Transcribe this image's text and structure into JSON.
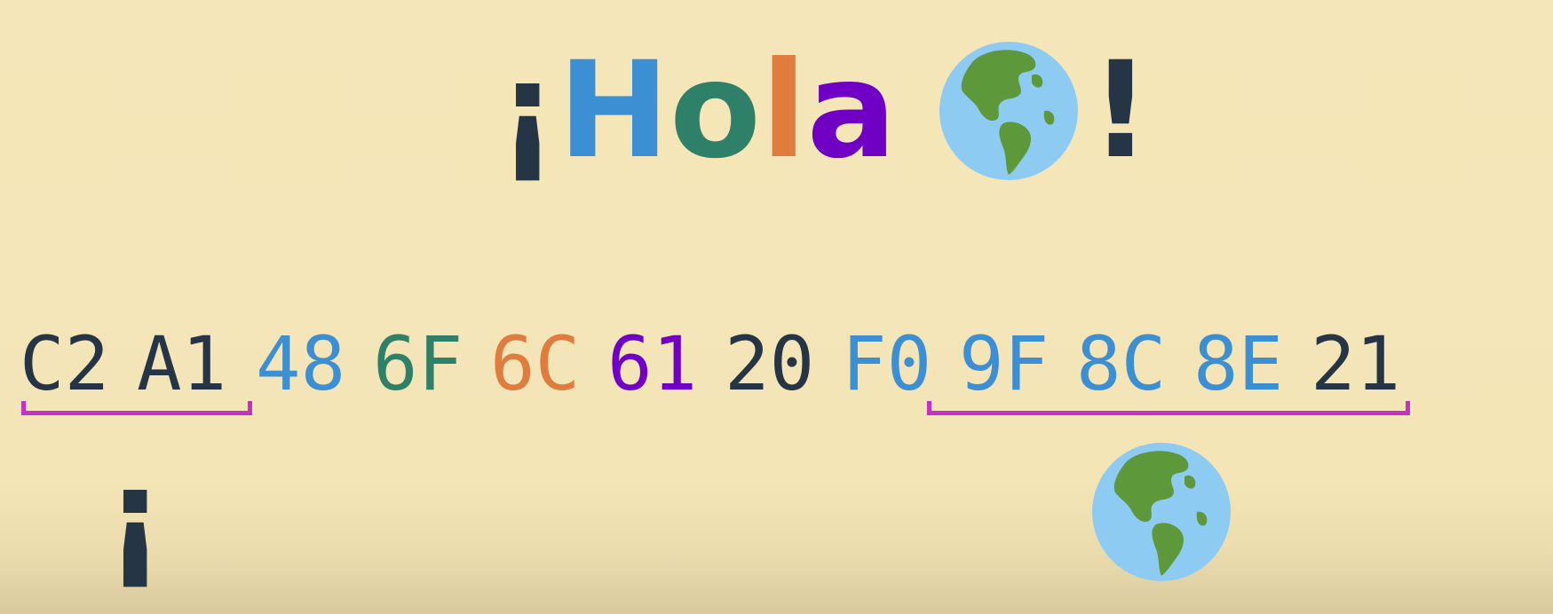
{
  "title": {
    "chars": [
      {
        "text": "¡",
        "color": "#263545"
      },
      {
        "text": "H",
        "color": "#3d8fd4"
      },
      {
        "text": "o",
        "color": "#2e8068"
      },
      {
        "text": "l",
        "color": "#e07d3e"
      },
      {
        "text": "a",
        "color": "#7000c4"
      }
    ],
    "globe_icon": "globe-americas-icon",
    "bang": {
      "text": "!",
      "color": "#263545"
    }
  },
  "bytes": [
    {
      "text": "C2",
      "color": "#263545"
    },
    {
      "text": "A1",
      "color": "#263545"
    },
    {
      "text": "48",
      "color": "#3d8fd4"
    },
    {
      "text": "6F",
      "color": "#2e8068"
    },
    {
      "text": "6C",
      "color": "#e07d3e"
    },
    {
      "text": "61",
      "color": "#7000c4"
    },
    {
      "text": "20",
      "color": "#263545"
    },
    {
      "text": "F0",
      "color": "#3d8fd4"
    },
    {
      "text": "9F",
      "color": "#3d8fd4"
    },
    {
      "text": "8C",
      "color": "#3d8fd4"
    },
    {
      "text": "8E",
      "color": "#3d8fd4"
    },
    {
      "text": "21",
      "color": "#263545"
    }
  ],
  "bracket_color": "#c431c4",
  "decoded": {
    "inverted_exclamation": {
      "text": "¡",
      "color": "#263545"
    },
    "globe_icon": "globe-americas-icon"
  }
}
